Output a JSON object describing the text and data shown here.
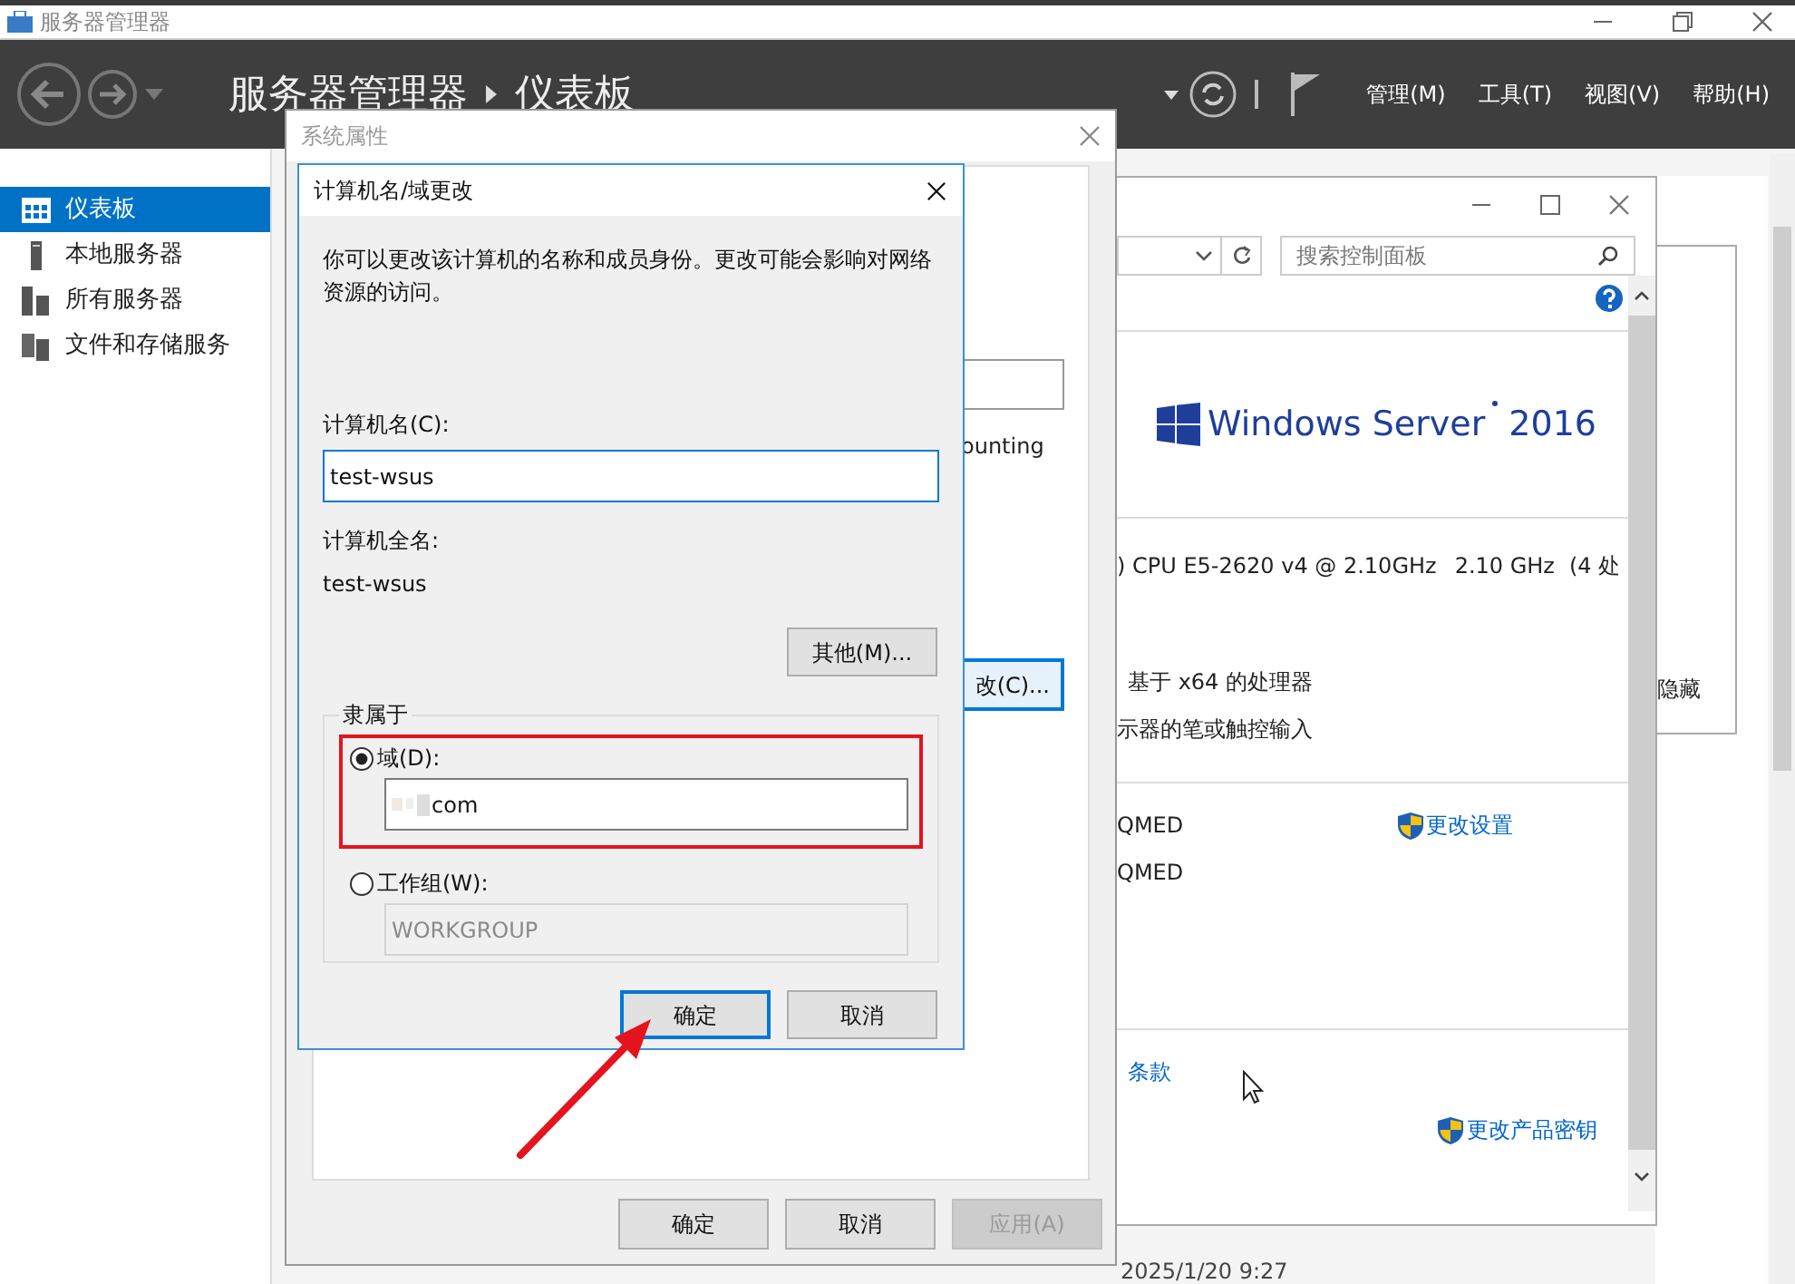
{
  "app_window": {
    "title": "服务器管理器"
  },
  "header": {
    "breadcrumb": [
      "服务器管理器",
      "仪表板"
    ],
    "menus": [
      "管理(M)",
      "工具(T)",
      "视图(V)",
      "帮助(H)"
    ]
  },
  "sidebar": {
    "items": [
      {
        "label": "仪表板",
        "selected": true,
        "kind": "dashboard"
      },
      {
        "label": "本地服务器",
        "selected": false,
        "kind": "server"
      },
      {
        "label": "所有服务器",
        "selected": false,
        "kind": "servers"
      },
      {
        "label": "文件和存储服务",
        "selected": false,
        "kind": "storage"
      }
    ]
  },
  "control_panel": {
    "search": {
      "placeholder": "搜索控制面板"
    },
    "logo": {
      "name": "Windows Server",
      "version": "2016"
    },
    "processor": {
      "model": ") CPU E5-2620 v4 @ 2.10GHz",
      "speed": "2.10 GHz",
      "count": "(4 处"
    },
    "system_type": "基于 x64 的处理器",
    "pen_touch": "示器的笔或触控输入",
    "computer_name": "QMED",
    "change_settings_link": "更改设置",
    "full_name": "QMED",
    "license_link": "条款",
    "product_key_link": "更改产品密钥"
  },
  "background": {
    "hide_label": "隐藏",
    "date": "2025/1/20 9:27"
  },
  "system_properties": {
    "title": "系统属性",
    "field_fragment": "ounting",
    "change_button": "改(C)...",
    "buttons": [
      {
        "label": "确定",
        "disabled": false
      },
      {
        "label": "取消",
        "disabled": false
      },
      {
        "label": "应用(A)",
        "disabled": true
      }
    ]
  },
  "rename_dialog": {
    "title": "计算机名/域更改",
    "description": "你可以更改该计算机的名称和成员身份。更改可能会影响对网络资源的访问。",
    "computer_name": {
      "label": "计算机名(C):",
      "value": "test-wsus"
    },
    "full_name": {
      "label": "计算机全名:",
      "value": "test-wsus"
    },
    "more_button": "其他(M)...",
    "member_of": {
      "legend": "隶属于",
      "options": [
        {
          "label": "域(D):",
          "selected": true,
          "value": "com",
          "highlighted": true
        },
        {
          "label": "工作组(W):",
          "selected": false,
          "value": "WORKGROUP",
          "highlighted": false
        }
      ]
    },
    "buttons": [
      {
        "label": "确定",
        "focused": true
      },
      {
        "label": "取消",
        "focused": false
      }
    ]
  }
}
